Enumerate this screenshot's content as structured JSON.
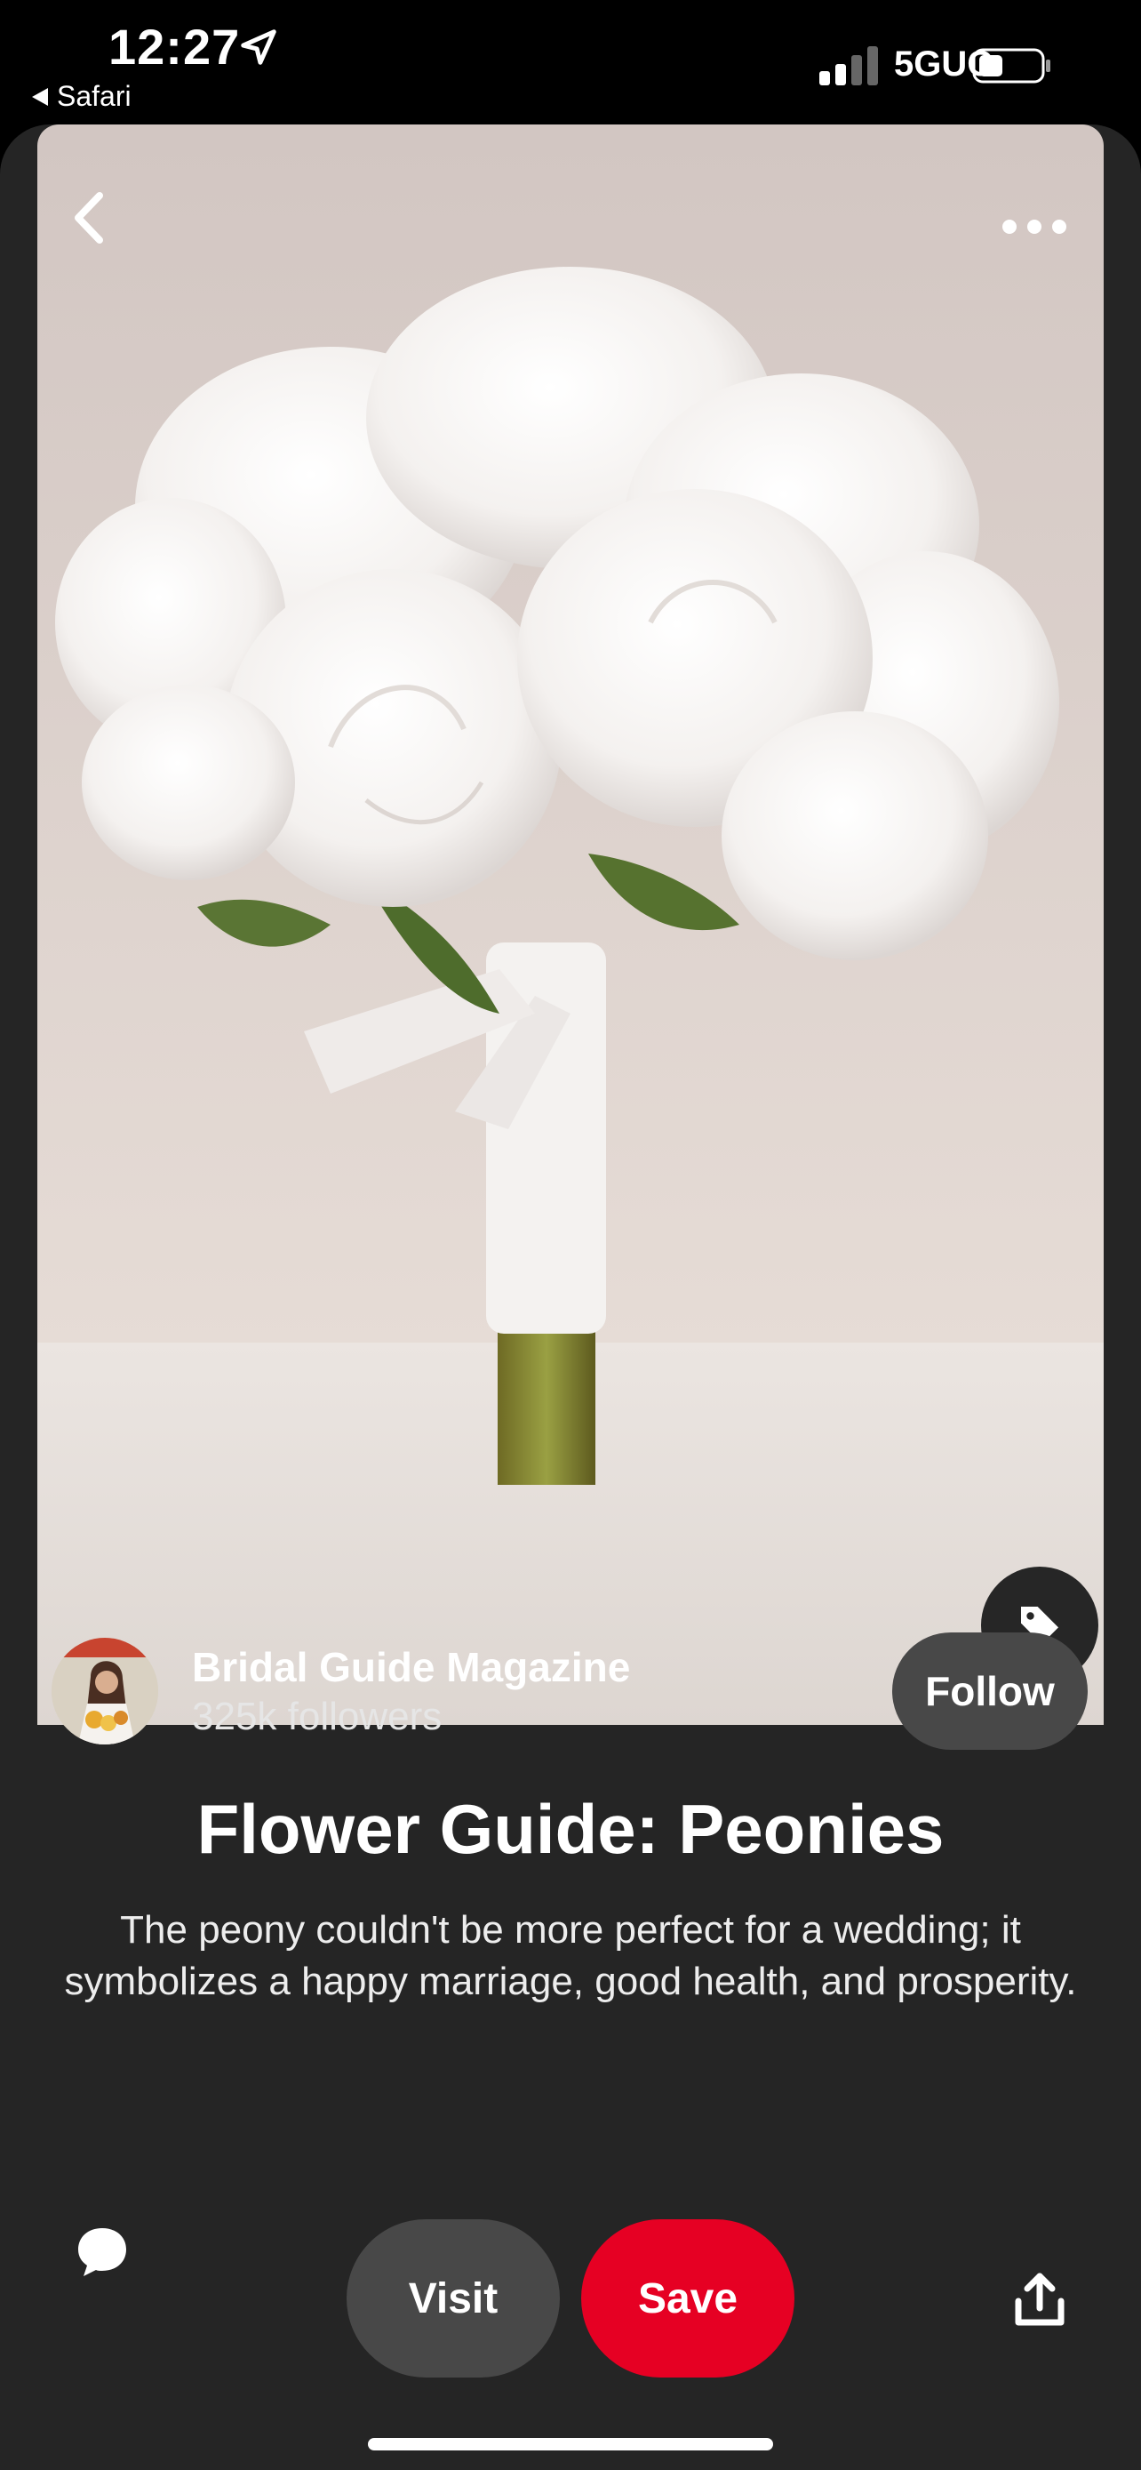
{
  "status_bar": {
    "time": "12:27",
    "back_app": "Safari",
    "network": "5GUC",
    "location_icon": "location-arrow-icon",
    "signal_icon": "signal-bars-icon",
    "battery_icon": "battery-icon"
  },
  "pin": {
    "image_alt": "White peony bridal bouquet",
    "back_icon": "chevron-left-icon",
    "more_icon": "more-dots-icon",
    "tag_icon": "tag-icon"
  },
  "creator": {
    "name": "Bridal Guide Magazine",
    "followers": "325k followers",
    "follow_label": "Follow"
  },
  "title": "Flower Guide: Peonies",
  "description": "The peony couldn't be more perfect for a wedding; it symbolizes a happy marriage, good health, and prosperity.",
  "actions": {
    "comment_icon": "comment-bubble-icon",
    "visit_label": "Visit",
    "save_label": "Save",
    "share_icon": "share-icon"
  },
  "colors": {
    "accent_save": "#e60023",
    "button_gray": "#484848",
    "card_bg": "#252525"
  }
}
